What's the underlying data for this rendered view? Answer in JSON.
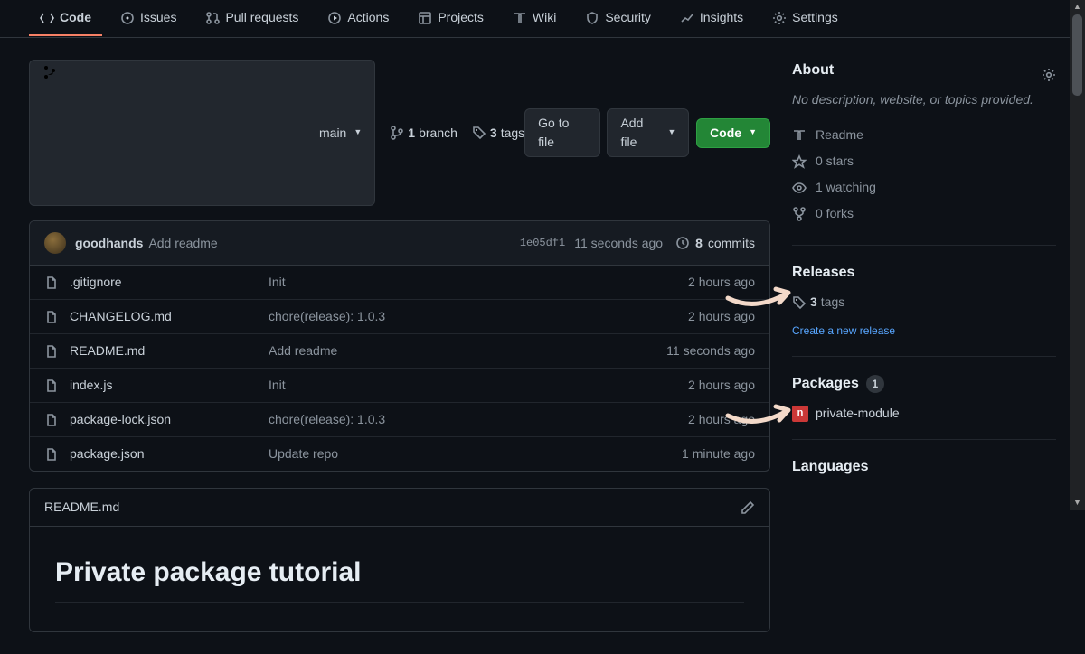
{
  "nav": {
    "tabs": [
      {
        "label": "Code",
        "icon": "code",
        "active": true
      },
      {
        "label": "Issues",
        "icon": "issue"
      },
      {
        "label": "Pull requests",
        "icon": "pr"
      },
      {
        "label": "Actions",
        "icon": "play"
      },
      {
        "label": "Projects",
        "icon": "project"
      },
      {
        "label": "Wiki",
        "icon": "book"
      },
      {
        "label": "Security",
        "icon": "shield"
      },
      {
        "label": "Insights",
        "icon": "graph"
      },
      {
        "label": "Settings",
        "icon": "gear"
      }
    ]
  },
  "toolbar": {
    "branch_button": "main",
    "branch_count": "1",
    "branch_word": "branch",
    "tag_count": "3",
    "tag_word": "tags",
    "go_to_file": "Go to file",
    "add_file": "Add file",
    "code": "Code"
  },
  "commit_bar": {
    "author": "goodhands",
    "message": "Add readme",
    "sha": "1e05df1",
    "time": "11 seconds ago",
    "commit_count": "8",
    "commit_word": "commits"
  },
  "files": [
    {
      "name": ".gitignore",
      "msg": "Init",
      "time": "2 hours ago"
    },
    {
      "name": "CHANGELOG.md",
      "msg": "chore(release): 1.0.3",
      "time": "2 hours ago"
    },
    {
      "name": "README.md",
      "msg": "Add readme",
      "time": "11 seconds ago"
    },
    {
      "name": "index.js",
      "msg": "Init",
      "time": "2 hours ago"
    },
    {
      "name": "package-lock.json",
      "msg": "chore(release): 1.0.3",
      "time": "2 hours ago"
    },
    {
      "name": "package.json",
      "msg": "Update repo",
      "time": "1 minute ago"
    }
  ],
  "readme": {
    "filename": "README.md",
    "heading": "Private package tutorial"
  },
  "about": {
    "title": "About",
    "description": "No description, website, or topics provided.",
    "readme": "Readme",
    "stars": "0 stars",
    "watching": "1 watching",
    "forks": "0 forks"
  },
  "releases": {
    "title": "Releases",
    "tags_count": "3",
    "tags_word": "tags",
    "create": "Create a new release"
  },
  "packages": {
    "title": "Packages",
    "count": "1",
    "item": "private-module"
  },
  "languages": {
    "title": "Languages"
  }
}
